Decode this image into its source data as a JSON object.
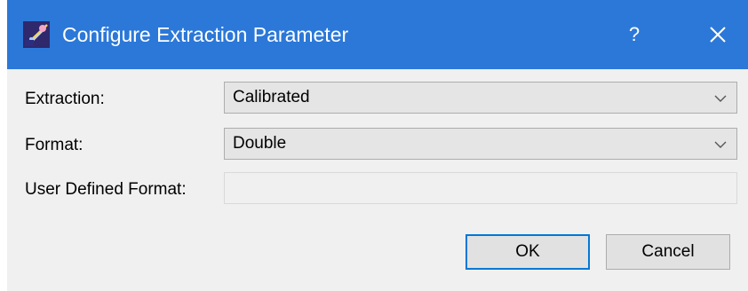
{
  "window": {
    "title": "Configure Extraction Parameter",
    "help_label": "?",
    "titlebar_color": "#2b78d8"
  },
  "form": {
    "extraction": {
      "label": "Extraction:",
      "value": "Calibrated"
    },
    "format": {
      "label": "Format:",
      "value": "Double"
    },
    "user_defined_format": {
      "label": "User Defined Format:",
      "value": ""
    }
  },
  "buttons": {
    "ok_label": "OK",
    "cancel_label": "Cancel",
    "focus_color": "#0078d7"
  },
  "icons": {
    "app": "app-logo-icon",
    "close": "close-icon",
    "dropdown": "chevron-down-icon"
  }
}
